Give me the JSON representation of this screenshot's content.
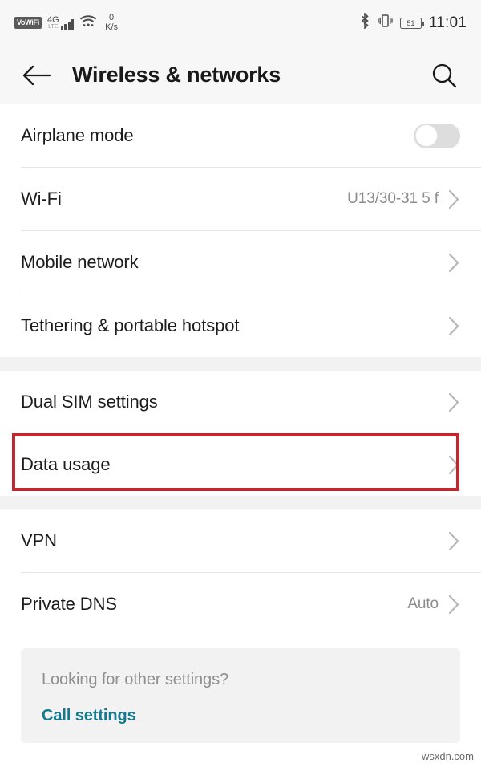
{
  "status_bar": {
    "vowifi_label": "VoWiFi",
    "network_type": "4G",
    "network_sub": "LTE",
    "data_rate_value": "0",
    "data_rate_unit": "K/s",
    "battery_level": "51",
    "time": "11:01",
    "icons": [
      "vowifi-badge",
      "signal-bars-icon",
      "wifi-icon",
      "bluetooth-icon",
      "vibrate-icon",
      "battery-icon"
    ]
  },
  "app_bar": {
    "back_icon": "back-arrow-icon",
    "title": "Wireless & networks",
    "search_icon": "search-icon"
  },
  "sections": [
    {
      "rows": [
        {
          "label": "Airplane mode",
          "value": "",
          "control": "toggle",
          "toggle_on": false
        },
        {
          "label": "Wi-Fi",
          "value": "U13/30-31 5 f",
          "control": "chevron"
        },
        {
          "label": "Mobile network",
          "value": "",
          "control": "chevron"
        },
        {
          "label": "Tethering & portable hotspot",
          "value": "",
          "control": "chevron"
        }
      ]
    },
    {
      "rows": [
        {
          "label": "Dual SIM settings",
          "value": "",
          "control": "chevron"
        },
        {
          "label": "Data usage",
          "value": "",
          "control": "chevron",
          "highlighted": true
        }
      ]
    },
    {
      "rows": [
        {
          "label": "VPN",
          "value": "",
          "control": "chevron"
        },
        {
          "label": "Private DNS",
          "value": "Auto",
          "control": "chevron"
        }
      ]
    }
  ],
  "footer_card": {
    "hint": "Looking for other settings?",
    "link_label": "Call settings"
  },
  "watermark": "wsxdn.com",
  "colors": {
    "highlight_red": "#c0282d",
    "link_teal": "#14788f",
    "status_bg": "#f7f7f7",
    "section_gap": "#f2f2f2"
  }
}
